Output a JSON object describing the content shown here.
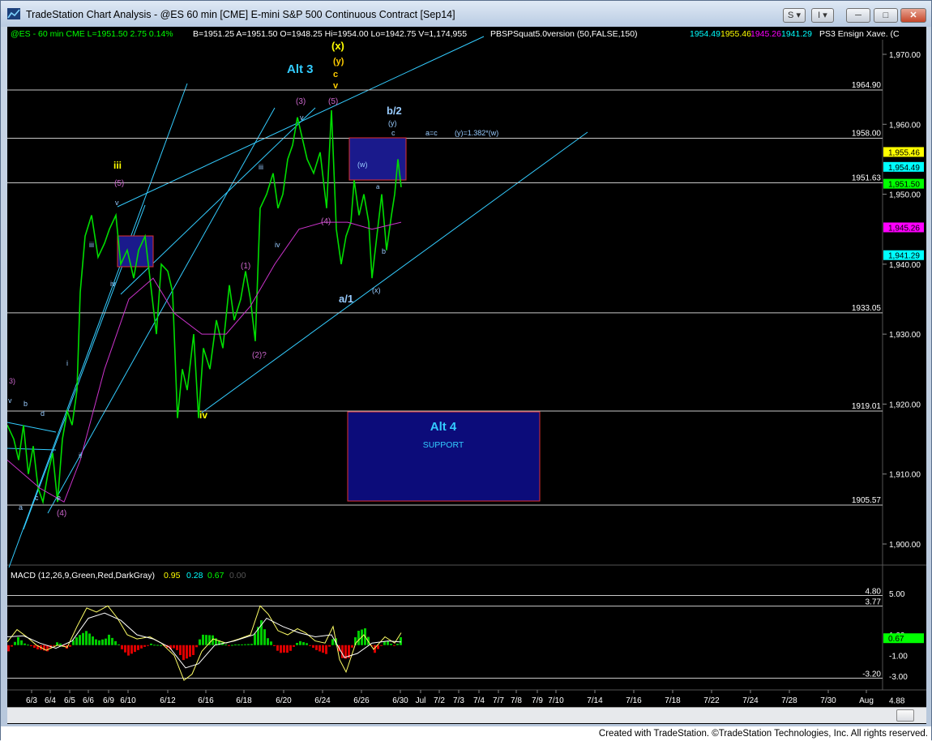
{
  "window": {
    "title": "TradeStation Chart Analysis - @ES 60 min [CME] E-mini S&P 500 Continuous Contract [Sep14]",
    "buttons": {
      "s": "S",
      "i": "I"
    }
  },
  "header": {
    "symbol": "@ES - 60 min  CME  L=1951.50  2.75  0.14%",
    "quote": "B=1951.25  A=1951.50  O=1948.25  Hi=1954.00  Lo=1942.75  V=1,174,955",
    "study": "PBSPSquat5.0version (50,FALSE,150)",
    "study_vals": [
      "1954.49",
      "1955.46",
      "1945.26",
      "1941.29"
    ],
    "study_colors": [
      "#00ffff",
      "#ffff00",
      "#ff00ff",
      "#00ffff"
    ],
    "ensign": "PS3 Ensign Xave. (C"
  },
  "price_axis": {
    "ticks": [
      "1,970.00",
      "1,960.00",
      "1,950.00",
      "1,940.00",
      "1,930.00",
      "1,920.00",
      "1,910.00",
      "1,900.00"
    ],
    "tick_values": [
      1970,
      1960,
      1950,
      1940,
      1930,
      1920,
      1910,
      1900
    ],
    "range": [
      1895,
      1975
    ],
    "markers": [
      {
        "label": "1,955.46",
        "value": 1955.46,
        "color": "#ffff00"
      },
      {
        "label": "1,954.49",
        "value": 1954.49,
        "color": "#00ffff"
      },
      {
        "label": "1,951.50",
        "value": 1951.5,
        "color": "#00ff00"
      },
      {
        "label": "1,945.26",
        "value": 1945.26,
        "color": "#ff00ff"
      },
      {
        "label": "1,941.29",
        "value": 1941.29,
        "color": "#00ffff"
      }
    ]
  },
  "levels": [
    {
      "label": "1964.90",
      "value": 1964.9
    },
    {
      "label": "1958.00",
      "value": 1958.0
    },
    {
      "label": "1951.63",
      "value": 1951.63
    },
    {
      "label": "1933.05",
      "value": 1933.05
    },
    {
      "label": "1919.01",
      "value": 1919.01
    },
    {
      "label": "1905.57",
      "value": 1905.57
    }
  ],
  "wave_labels": [
    {
      "text": "Alt 3",
      "color": "#33ccff"
    },
    {
      "text": "(x)",
      "color": "#ffff00"
    },
    {
      "text": "(y)",
      "color": "#ffcc00"
    },
    {
      "text": "c",
      "color": "#ffcc00"
    },
    {
      "text": "v",
      "color": "#ffcc00"
    },
    {
      "text": "b/2",
      "color": "#99ccff"
    },
    {
      "text": "(y)",
      "color": "#99ccff"
    },
    {
      "text": "c",
      "color": "#99ccff"
    },
    {
      "text": "a=c",
      "color": "#99ccff"
    },
    {
      "text": "(y)=1.382*(w)",
      "color": "#99ccff"
    },
    {
      "text": "(3)",
      "color": "#cc66cc"
    },
    {
      "text": "(5)",
      "color": "#cc66cc"
    },
    {
      "text": "v",
      "color": "#99ccff"
    },
    {
      "text": "iii",
      "color": "#99ccff"
    },
    {
      "text": "iii",
      "color": "#ffff00"
    },
    {
      "text": "(5)",
      "color": "#cc66cc"
    },
    {
      "text": "v",
      "color": "#99ccff"
    },
    {
      "text": "iii",
      "color": "#99ccff"
    },
    {
      "text": "iv",
      "color": "#99ccff"
    },
    {
      "text": "(w)",
      "color": "#99ccff"
    },
    {
      "text": "a",
      "color": "#99ccff"
    },
    {
      "text": "b",
      "color": "#99ccff"
    },
    {
      "text": "(4)",
      "color": "#cc66cc"
    },
    {
      "text": "iv",
      "color": "#99ccff"
    },
    {
      "text": "(1)",
      "color": "#cc66cc"
    },
    {
      "text": "(2)?",
      "color": "#cc66cc"
    },
    {
      "text": "a/1",
      "color": "#99ccff"
    },
    {
      "text": "(x)",
      "color": "#99ccff"
    },
    {
      "text": "iv",
      "color": "#ffff00"
    },
    {
      "text": "i",
      "color": "#99ccff"
    },
    {
      "text": "ii",
      "color": "#99ccff"
    },
    {
      "text": "3)",
      "color": "#cc66cc"
    },
    {
      "text": "v",
      "color": "#99ccff"
    },
    {
      "text": "b",
      "color": "#99ccff"
    },
    {
      "text": "d",
      "color": "#99ccff"
    },
    {
      "text": "a",
      "color": "#99ccff"
    },
    {
      "text": "c",
      "color": "#99ccff"
    },
    {
      "text": "e",
      "color": "#99ccff"
    },
    {
      "text": "(4)",
      "color": "#cc66cc"
    }
  ],
  "support_box": {
    "title": "Alt 4",
    "subtitle": "SUPPORT"
  },
  "macd": {
    "label": "MACD (12,26,9,Green,Red,DarkGray)",
    "values": [
      {
        "v": "0.95",
        "color": "#ffff00"
      },
      {
        "v": "0.28",
        "color": "#00ffff"
      },
      {
        "v": "0.67",
        "color": "#00ff00"
      },
      {
        "v": "0.00",
        "color": "#555555"
      }
    ],
    "levels": [
      {
        "label": "4.80",
        "value": 4.8
      },
      {
        "label": "3.77",
        "value": 3.77
      },
      {
        "label": "-3.20",
        "value": -3.2
      }
    ],
    "ticks": [
      "5.00",
      "1.00",
      "-1.00",
      "-3.00",
      "4.88"
    ],
    "tick_values": [
      5,
      1,
      -1,
      -3,
      -5.3
    ],
    "marker": {
      "label": "0.67",
      "value": 0.67
    }
  },
  "date_axis": [
    "6/3",
    "6/4",
    "6/5",
    "6/6",
    "6/9",
    "6/10",
    "6/12",
    "6/16",
    "6/18",
    "6/20",
    "6/24",
    "6/26",
    "6/30",
    "Jul",
    "7/2",
    "7/3",
    "7/4",
    "7/7",
    "7/8",
    "7/9",
    "7/10",
    "7/14",
    "7/16",
    "7/18",
    "7/22",
    "7/24",
    "7/28",
    "7/30",
    "Aug"
  ],
  "footer": "Created with TradeStation. ©TradeStation Technologies, Inc. All rights reserved."
}
